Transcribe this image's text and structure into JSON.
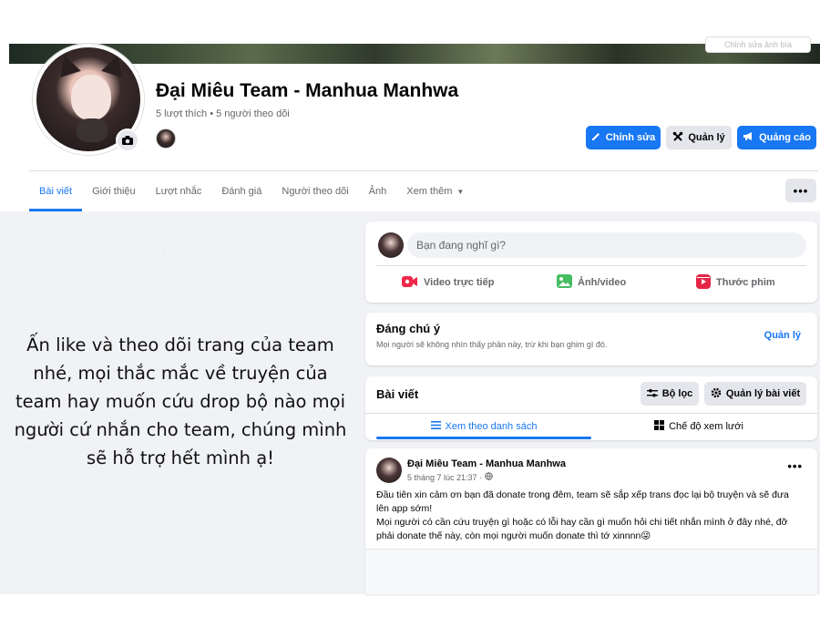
{
  "cover": {
    "button_text": "Chỉnh sửa ảnh bìa"
  },
  "page": {
    "title": "Đại Miêu Team - Manhua Manhwa",
    "stats": "5 lượt thích • 5 người theo dõi"
  },
  "header_buttons": {
    "edit": "Chỉnh sửa",
    "manage": "Quản lý",
    "advertise": "Quảng cáo"
  },
  "tabs": [
    "Bài viết",
    "Giới thiệu",
    "Lượt nhắc",
    "Đánh giá",
    "Người theo dõi",
    "Ảnh",
    "Xem thêm"
  ],
  "more_label": "•••",
  "promo_text": "Ấn like và theo dõi trang của team nhé, mọi thắc mắc về truyện của team hay muốn cứu drop bộ nào mọi người cứ nhắn cho team, chúng mình sẽ hỗ trợ hết mình ạ!",
  "composer": {
    "placeholder": "Bạn đang nghĩ gì?",
    "actions": [
      "Video trực tiếp",
      "Ảnh/video",
      "Thước phim"
    ]
  },
  "notable": {
    "title": "Đáng chú ý",
    "subtitle": "Mọi người sẽ không nhìn thấy phần này, trừ khi bạn ghim gì đó.",
    "link": "Quản lý"
  },
  "posts": {
    "title": "Bài viết",
    "filter": "Bộ lọc",
    "manage": "Quản lý bài viết",
    "view_list": "Xem theo danh sách",
    "view_grid": "Chế độ xem lưới"
  },
  "post": {
    "author": "Đại Miêu Team - Manhua Manhwa",
    "time": "5 tháng 7 lúc 21:37 ·",
    "text_lines": [
      "Đầu tiên xin cảm ơn bạn đã donate trong đêm, team sẽ sắp xếp trans đọc lại bộ truyện và sẽ đưa",
      "lên app sớm!",
      "Mọi người có cần cứu truyện gì hoặc có lỗi hay cần gì muốn hỏi chi tiết nhắn mình ở đây nhé, đỡ",
      "phải donate thế này, còn mọi người muốn donate thì tớ xinnnn😜"
    ],
    "more": "•••"
  },
  "colors": {
    "accent": "#1877f2",
    "background": "#f0f2f5",
    "secondary_text": "#65676b",
    "button_gray": "#e4e6eb",
    "live_red": "#f02849",
    "photo_green": "#45bd62",
    "reel_pink": "#e42645"
  },
  "icons": [
    "camera-icon",
    "pencil-icon",
    "tools-icon",
    "megaphone-icon",
    "live-video-icon",
    "photo-icon",
    "reel-icon",
    "filter-icon",
    "gear-icon",
    "list-icon",
    "grid-icon",
    "globe-icon",
    "more-icon"
  ]
}
